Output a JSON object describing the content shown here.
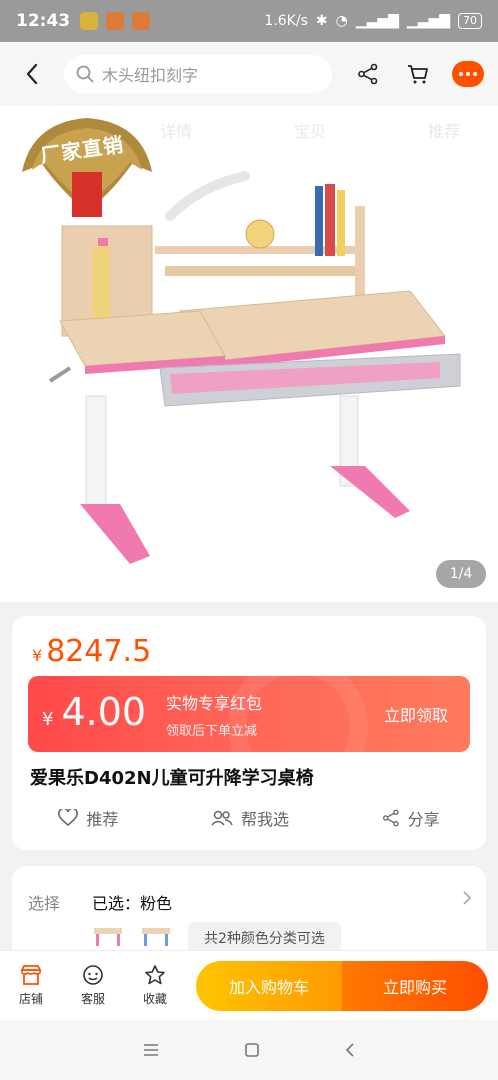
{
  "status_bar": {
    "time": "12:43",
    "network_speed": "1.6K/s",
    "battery": "70"
  },
  "top_bar": {
    "search_placeholder": "木头纽扣刻字"
  },
  "hero": {
    "faint_tabs": [
      "详情",
      "宝贝",
      "推荐"
    ],
    "badge_text": "厂家直销",
    "page_indicator": "1/4"
  },
  "product": {
    "price_currency": "¥",
    "price": "8247.5",
    "coupon": {
      "currency": "¥",
      "amount": "4.00",
      "title": "实物专享红包",
      "subtitle": "领取后下单立减",
      "button": "立即领取"
    },
    "title": "爱果乐D402N儿童可升降学习桌椅",
    "actions": [
      {
        "label": "推荐",
        "icon": "heart-icon"
      },
      {
        "label": "帮我选",
        "icon": "people-icon"
      },
      {
        "label": "分享",
        "icon": "share-icon"
      }
    ]
  },
  "selection": {
    "label": "选择",
    "value": "已选：粉色",
    "hint": "共2种颜色分类可选"
  },
  "bottom_bar": {
    "nav": [
      {
        "label": "店铺",
        "icon": "store-icon"
      },
      {
        "label": "客服",
        "icon": "service-icon"
      },
      {
        "label": "收藏",
        "icon": "star-icon"
      }
    ],
    "add_to_cart": "加入购物车",
    "buy_now": "立即购买"
  },
  "colors": {
    "accent": "#ff5000",
    "coupon_red": "#ff4a4a",
    "cart_yellow": "#ffb000",
    "desk_pink": "#f07ab0"
  }
}
